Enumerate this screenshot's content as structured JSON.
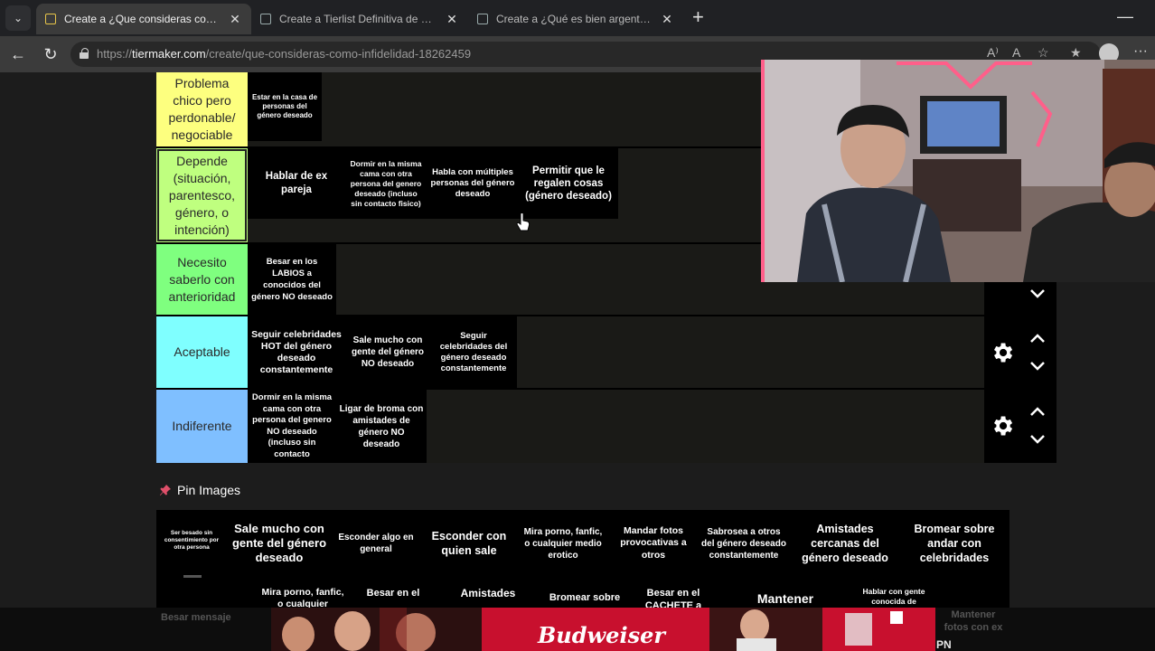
{
  "browser": {
    "tabs": [
      {
        "title": "Create a ¿Que consideras como infidelidad?",
        "active": true
      },
      {
        "title": "Create a Tierlist Definitiva de Comida",
        "active": false
      },
      {
        "title": "Create a ¿Qué es bien argentino y qué no?",
        "active": false
      }
    ],
    "url_prefix": "https://",
    "url_host": "tiermaker.com",
    "url_path": "/create/que-consideras-como-infidelidad-18262459"
  },
  "tiers": [
    {
      "label": "Problema chico pero perdonable/ negociable",
      "color": "#fdff7f",
      "items": [
        "Estar en la casa de personas del género deseado"
      ]
    },
    {
      "label": "Depende (situación, parentesco, género, o intención)",
      "color": "#bfff7f",
      "items": [
        "Hablar de ex pareja",
        "Dormir en la misma cama con otra persona del genero deseado (incluso sin contacto fisico)",
        "Habla con múltiples personas del género deseado",
        "Permitir que le regalen cosas (género deseado)"
      ]
    },
    {
      "label": "Necesito saberlo con anterioridad",
      "color": "#7fff7f",
      "items": [
        "Besar en los LABIOS a conocidos del género NO deseado"
      ]
    },
    {
      "label": "Aceptable",
      "color": "#7fffff",
      "items": [
        "Seguir celebridades HOT del género deseado constantemente",
        "Sale mucho con gente del género NO deseado",
        "Seguir celebridades del género deseado constantemente"
      ]
    },
    {
      "label": "Indiferente",
      "color": "#7fbfff",
      "items": [
        "Dormir en la misma cama con otra persona del genero NO deseado (incluso sin contacto",
        "Ligar de broma con amistades de género NO deseado"
      ]
    }
  ],
  "pin_images_label": "Pin Images",
  "pool_items": [
    "Ser besado sin consentimiento por otra persona",
    "Sale mucho con gente del género deseado",
    "Esconder algo en general",
    "Esconder con quien sale",
    "Mira porno, fanfic, o cualquier medio erotico",
    "Mandar fotos provocativas a otros",
    "Sabrosea a otros del género deseado constantemente",
    "Amistades cercanas del género deseado",
    "Bromear sobre andar con celebridades"
  ],
  "pool_row2": [
    "Mira porno, fanfic, o cualquier",
    "Besar en el",
    "Amistades",
    "Bromear sobre",
    "Besar en el CACHETE a",
    "Mantener",
    "Hablar con gente conocida de"
  ],
  "pool_row2_faded": [
    "Besar mensaje",
    "Mantener fotos con ex"
  ],
  "ad": {
    "brand": "Budweiser",
    "badge": "PN"
  },
  "colors": {
    "gear": "#ffffff",
    "pin": "#e0506a",
    "ad_red": "#c8102e"
  }
}
